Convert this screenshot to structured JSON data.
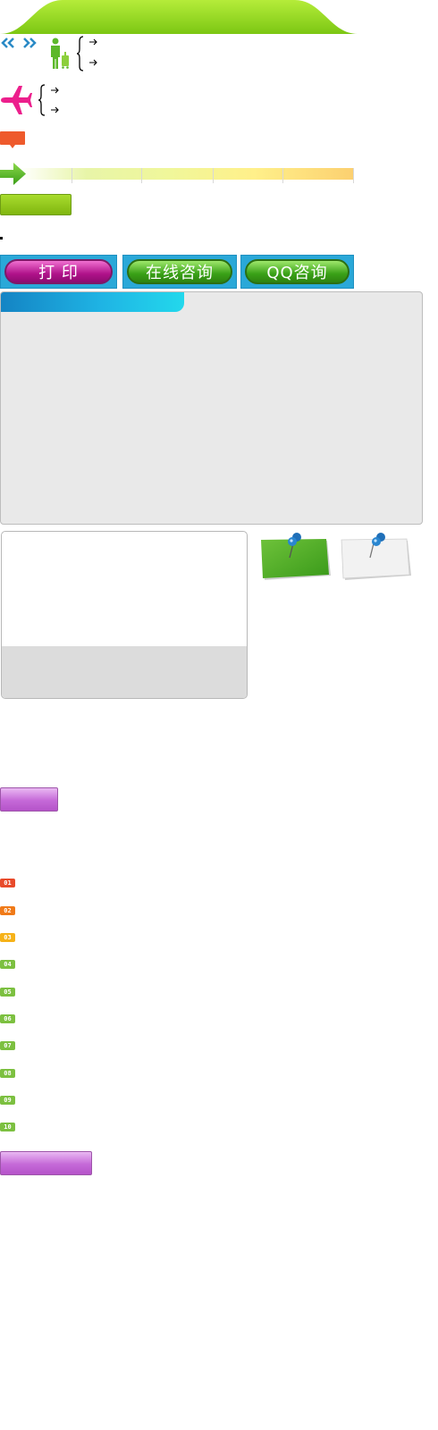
{
  "buttons": {
    "print": "打 印",
    "online_consult": "在线咨询",
    "qq_consult": "QQ咨询"
  },
  "rank_badges": [
    "01",
    "02",
    "03",
    "04",
    "05",
    "06",
    "07",
    "08",
    "09",
    "10"
  ],
  "colors": {
    "top_tab": "#9bd920",
    "button_frame": "#2aa8d8",
    "badge_1": "#e84a2a",
    "badge_2": "#f07a18",
    "badge_3": "#f6b218",
    "badge_rest": "#7cc040",
    "purple": "#c569d8",
    "panel_bg": "#e9e9e9"
  },
  "icons": [
    "double-left-arrow-icon",
    "double-right-arrow-icon",
    "person-luggage-icon",
    "airplane-icon",
    "comment-icon",
    "green-arrow-icon",
    "pushpin-note-green-icon",
    "pushpin-note-white-icon"
  ]
}
